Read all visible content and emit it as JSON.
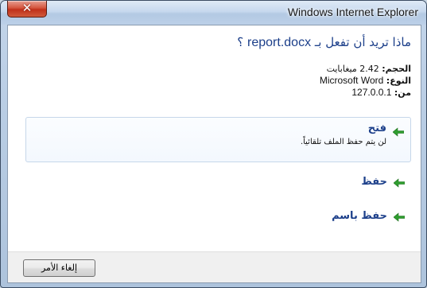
{
  "window": {
    "title": "Windows Internet Explorer",
    "close_label": "✕"
  },
  "dialog": {
    "question_prefix": "ماذا تريد أن تفعل بـ",
    "file_name": "report.docx",
    "question_suffix": "؟",
    "info": {
      "size_label": "الحجم:",
      "size_value": "2.42 ميغابايت",
      "type_label": "النوع:",
      "type_value": "Microsoft Word",
      "from_label": "من:",
      "from_value": "127.0.0.1"
    },
    "options": [
      {
        "title": "فتح",
        "subtitle": "لن يتم حفظ الملف تلقائياً.",
        "icon": "green-arrow-icon"
      },
      {
        "title": "حفظ",
        "icon": "green-arrow-icon"
      },
      {
        "title": "حفظ باسم",
        "icon": "green-arrow-icon"
      }
    ],
    "cancel_label": "إلغاء الأمر"
  },
  "colors": {
    "accent_text": "#1c3f8a",
    "arrow_green": "#2f9e2f",
    "close_red": "#c0301a"
  }
}
